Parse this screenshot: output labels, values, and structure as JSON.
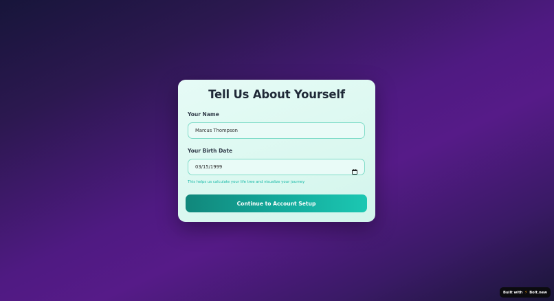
{
  "form": {
    "title": "Tell Us About Yourself",
    "name_label": "Your Name",
    "name_value": "Marcus Thompson",
    "birth_label": "Your Birth Date",
    "birth_value": "03/15/1999",
    "hint": "This helps us calculate your life tree and visualize your journey",
    "continue_label": "Continue to Account Setup"
  },
  "badge": {
    "built_with": "Built with",
    "brand": "Bolt.new"
  },
  "colors": {
    "accent": "#14b8a6",
    "title_text": "#1f2937",
    "button_start": "#11877b",
    "button_end": "#1cc7b2"
  },
  "icons": {
    "date_field": "calendar-icon",
    "badge": "bolt-icon"
  }
}
